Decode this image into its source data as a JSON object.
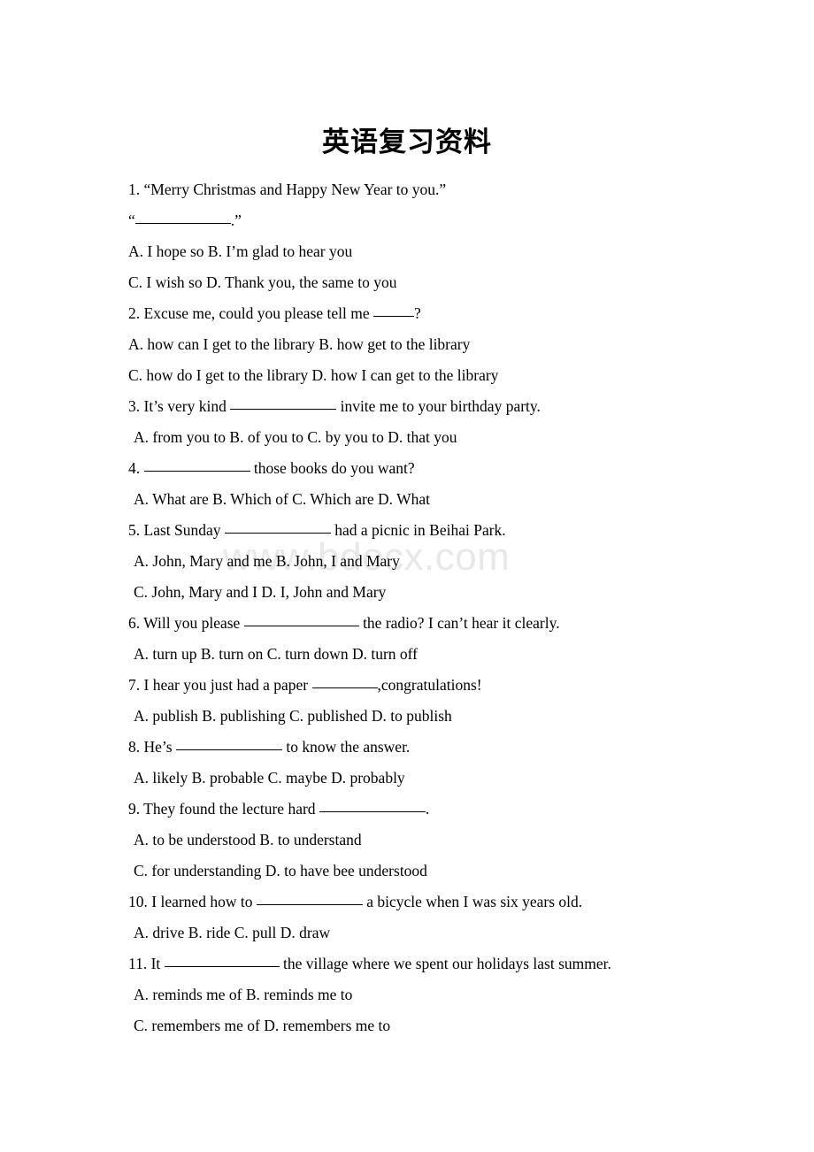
{
  "document": {
    "title": "英语复习资料",
    "watermark": "www.bdocx.com"
  },
  "questions": [
    {
      "stem_prefix": "1. “Merry Christmas and Happy New Year to you.”",
      "stem_quote_open": "“",
      "stem_quote_close": ".”",
      "options_line_1": "A. I hope so     B. I’m glad to hear you",
      "options_line_2": "C. I wish so     D. Thank you, the same to you"
    },
    {
      "stem_before": "2. Excuse me, could you please tell me ",
      "stem_after": "?",
      "options_line_1": "A. how can I get to the library B. how get to the library",
      "options_line_2": "C. how do I get to the library D. how I can get to the library"
    },
    {
      "stem_before": "3. It’s very kind ",
      "stem_after": " invite me to your birthday party.",
      "options_line_1": "A. from you to   B. of you to   C. by you to  D. that you"
    },
    {
      "stem_before": "4. ",
      "stem_after": " those books do you want?",
      "options_line_1": "A. What are  B. Which of  C. Which are  D. What"
    },
    {
      "stem_before": "5. Last Sunday ",
      "stem_after": " had a picnic in Beihai Park.",
      "options_line_1": "A. John, Mary and me   B. John, I and Mary",
      "options_line_2": "C. John, Mary and I    D. I, John and Mary"
    },
    {
      "stem_before": "6. Will you please ",
      "stem_after": " the radio? I can’t hear it clearly.",
      "options_line_1": "A. turn up  B. turn on  C. turn down  D. turn off"
    },
    {
      "stem_before": "7. I hear you just had a paper ",
      "stem_after": ",congratulations!",
      "options_line_1": "A. publish  B. publishing  C. published D. to publish"
    },
    {
      "stem_before": "8. He’s ",
      "stem_after": " to know the answer.",
      "options_line_1": "A. likely  B. probable  C. maybe  D. probably"
    },
    {
      "stem_before": "9. They found the lecture hard ",
      "stem_after": ".",
      "options_line_1": "A. to be understood    B. to understand",
      "options_line_2": "C. for understanding    D. to have bee understood"
    },
    {
      "stem_before": "10. I learned how to ",
      "stem_after": " a bicycle when I was six years old.",
      "options_line_1": "A. drive  B. ride   C. pull   D. draw"
    },
    {
      "stem_before": "11. It ",
      "stem_after": " the village where we spent our holidays last summer.",
      "options_line_1": "A. reminds me of   B. reminds me to",
      "options_line_2": "C. remembers me of   D. remembers me to"
    }
  ],
  "colors": {
    "text": "#000000",
    "background": "#ffffff",
    "watermark": "#e8e8e8"
  }
}
